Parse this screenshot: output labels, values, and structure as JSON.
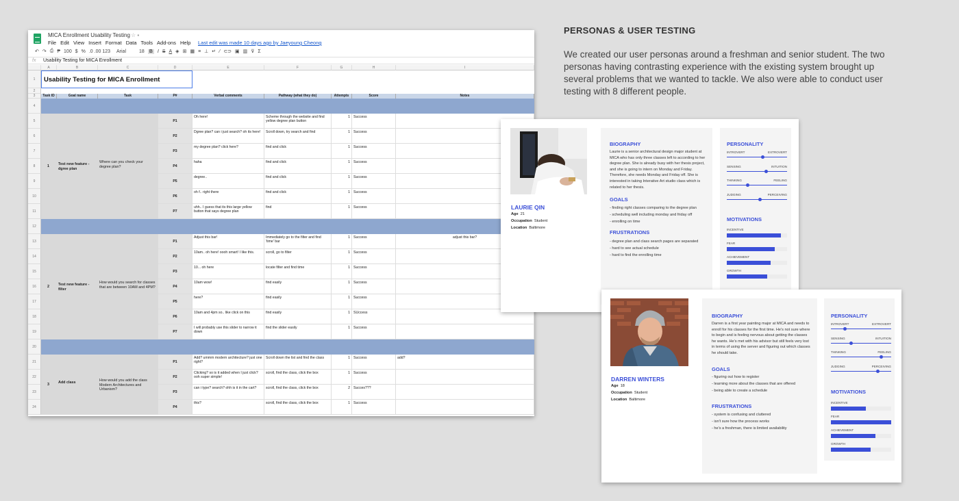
{
  "spreadsheet": {
    "doc_title": "MICA Enrollment Usability Testing",
    "menu": [
      "File",
      "Edit",
      "View",
      "Insert",
      "Format",
      "Data",
      "Tools",
      "Add-ons",
      "Help"
    ],
    "last_edit": "Last edit was made 10 days ago by Jaeyoung Cheong",
    "toolbar": {
      "zoom": "100",
      "currency": "$",
      "percent": "%",
      "decimals": ".0  .00  123",
      "font": "Arial",
      "size": "18",
      "bold": "B"
    },
    "formula_label": "fx",
    "formula_value": "Usability Testing for MICA Enrollment",
    "col_letters": [
      "A",
      "B",
      "C",
      "D",
      "E",
      "F",
      "G",
      "H",
      "I"
    ],
    "title": "Usability Testing for MICA Enrollment",
    "headers": [
      "Task ID",
      "Goal name",
      "Task",
      "P#",
      "Verbal comments",
      "Pathway (what they do)",
      "Attempts",
      "Score",
      "Notes"
    ],
    "row_numbers": [
      "1",
      "2",
      "3",
      "4",
      "5",
      "6",
      "7",
      "8",
      "9",
      "10",
      "11",
      "12",
      "13",
      "14",
      "15",
      "16",
      "17",
      "18",
      "19",
      "20",
      "21",
      "22",
      "23",
      "24"
    ],
    "tasks": [
      {
        "id": "1",
        "goal": "Test new feature - dgree plan",
        "task": "Where can you check your degree plan?"
      },
      {
        "id": "2",
        "goal": "Test new feature - filter",
        "task": "How would you search for classes that are between 10AM and 4PM?"
      },
      {
        "id": "3",
        "goal": "Add class",
        "task": "How would you add the class Modern Architectures and Urbanism?"
      }
    ],
    "rows": [
      {
        "p": "P1",
        "comment": "Oh here!",
        "path": "Scheme through the website and find yellow degree plan button",
        "att": "1",
        "score": "Success",
        "notes": ""
      },
      {
        "p": "P2",
        "comment": "Dgree plan? can i just search? oh its here!",
        "path": "Scroll down, try search and find",
        "att": "1",
        "score": "Success",
        "notes": ""
      },
      {
        "p": "P3",
        "comment": "my degree plan? click here?",
        "path": "find and click",
        "att": "1",
        "score": "Success",
        "notes": ""
      },
      {
        "p": "P4",
        "comment": "haha",
        "path": "find and click",
        "att": "1",
        "score": "Success",
        "notes": ""
      },
      {
        "p": "P5",
        "comment": "degree..",
        "path": "find and click",
        "att": "1",
        "score": "Success",
        "notes": ""
      },
      {
        "p": "P6",
        "comment": "oh f.. right there",
        "path": "find and click",
        "att": "1",
        "score": "Success",
        "notes": ""
      },
      {
        "p": "P7",
        "comment": "uhh.. I guess that its this large yellow button that says degree plan",
        "path": "find",
        "att": "1",
        "score": "Success",
        "notes": ""
      },
      {
        "p": "P1",
        "comment": "Adjust this bar!",
        "path": "Immediately go to the filter and find 'time' bar",
        "att": "1",
        "score": "Success",
        "notes": "adjust this bar?"
      },
      {
        "p": "P2",
        "comment": "10am.. oh here! oooh smart! I like this.",
        "path": "scroll, go to filter",
        "att": "1",
        "score": "Success",
        "notes": ""
      },
      {
        "p": "P3",
        "comment": "10... oh here",
        "path": "locate filter and find time",
        "att": "1",
        "score": "Success",
        "notes": ""
      },
      {
        "p": "P4",
        "comment": "10am wow!",
        "path": "find easily",
        "att": "1",
        "score": "Success",
        "notes": ""
      },
      {
        "p": "P5",
        "comment": "here?",
        "path": "find easily",
        "att": "1",
        "score": "Success",
        "notes": ""
      },
      {
        "p": "P6",
        "comment": "10am and 4pm so.. like click on this",
        "path": "find easily",
        "att": "1",
        "score": "SUccess",
        "notes": ""
      },
      {
        "p": "P7",
        "comment": "I will probably use this slider to narrow it down",
        "path": "find the slider easily",
        "att": "1",
        "score": "Success",
        "notes": ""
      },
      {
        "p": "P1",
        "comment": "Add? ummm modern architecture? just one right?",
        "path": "Scroll down the list and find the class",
        "att": "1",
        "score": "Success",
        "notes": "add?"
      },
      {
        "p": "P2",
        "comment": "Clicking? so is it added when I just click? ooh super simple!",
        "path": "scroll, find the class, click the box",
        "att": "1",
        "score": "Success",
        "notes": ""
      },
      {
        "p": "P3",
        "comment": "can i type? search? ohh is it in the cart?",
        "path": "scroll, find the class, click the box",
        "att": "2",
        "score": "Succes???",
        "notes": ""
      },
      {
        "p": "P4",
        "comment": "this?",
        "path": "scroll, find the class, click the box",
        "att": "1",
        "score": "Success",
        "notes": ""
      }
    ]
  },
  "section": {
    "title": "PERSONAS & USER TESTING",
    "body": "We created our user personas around a freshman and senior student. The two personas having contrasting experience with the existing system brought up several problems that we wanted to tackle. We also were able to conduct user testing with 8 different people."
  },
  "personas": [
    {
      "name": "LAURIE QIN",
      "age_label": "Age",
      "age": "21",
      "occ_label": "Occupation",
      "occupation": "Student",
      "loc_label": "Location",
      "location": "Baltimore",
      "bio_title": "BIOGRAPHY",
      "bio": "Laurie is a senior architectural design major student at MICA who has only three classes left to according to her degree plan. She is already busy with her thesis project, and she is going to intern on Monday and Friday. Therefore, she needs Monday and Friday off. She is interested in taking Interative Art studio class which is related to her thesis.",
      "goals_title": "GOALS",
      "goals": [
        "- finding right classes comparing to the degree plan",
        "- scheduling well including monday and friday off",
        "- enrolling on time"
      ],
      "frus_title": "FRUSTRATIONS",
      "frustrations": [
        "- degree plan and class search pages are separated",
        "- hard to see actual schedule",
        "- hard to find the enrolling time"
      ],
      "personality_title": "PERSONALITY",
      "personality": [
        {
          "left": "INTROVERT",
          "right": "EXTROVERT",
          "value": 0.6
        },
        {
          "left": "SENSING",
          "right": "INTUITION",
          "value": 0.65
        },
        {
          "left": "THINKING",
          "right": "FEELING",
          "value": 0.35
        },
        {
          "left": "JUDGING",
          "right": "PERCEIVING",
          "value": 0.55
        }
      ],
      "motivations_title": "MOTIVATIONS",
      "motivations": [
        {
          "label": "INCENTIVE",
          "value": 0.9
        },
        {
          "label": "FEAR",
          "value": 0.79
        },
        {
          "label": "ACHIEVEMENT",
          "value": 0.73
        },
        {
          "label": "GROWTH",
          "value": 0.67
        }
      ]
    },
    {
      "name": "DARREN WINTERS",
      "age_label": "Age",
      "age": "18",
      "occ_label": "Occupation",
      "occupation": "Student",
      "loc_label": "Location",
      "location": "Baltimore",
      "bio_title": "BIOGRAPHY",
      "bio": "Darren is a first year painting major at MICA and needs to enroll for his classes for the first time. He's not sure where to begin and is feeling nervous about getting the classes he wants. He's met with his advisor but still feels very lost in terms of using the server and figuring out which classes he should take.",
      "goals_title": "GOALS",
      "goals": [
        "- figuring out how to register",
        "- learning more about the classes that are offered",
        "- being able to create a schedule"
      ],
      "frus_title": "FRUSTRATIONS",
      "frustrations": [
        "- system is confusing and cluttered",
        "- isn't sure how the process works",
        "- he's a freshman, there is limited availability"
      ],
      "personality_title": "PERSONALITY",
      "personality": [
        {
          "left": "INTROVERT",
          "right": "EXTROVERT",
          "value": 0.23
        },
        {
          "left": "SENSING",
          "right": "INTUITION",
          "value": 0.33
        },
        {
          "left": "THINKING",
          "right": "FEELING",
          "value": 0.83
        },
        {
          "left": "JUDGING",
          "right": "PERCEIVING",
          "value": 0.78
        }
      ],
      "motivations_title": "MOTIVATIONS",
      "motivations": [
        {
          "label": "INCENTIVE",
          "value": 0.58
        },
        {
          "label": "FEAR",
          "value": 1.0
        },
        {
          "label": "ACHIEVEMENT",
          "value": 0.74
        },
        {
          "label": "GROWTH",
          "value": 0.66
        }
      ]
    }
  ],
  "colors": {
    "accent": "#3b4fd8",
    "band": "#8ea7cf",
    "header": "#c9d6e8",
    "background": "#dfdfdf"
  }
}
